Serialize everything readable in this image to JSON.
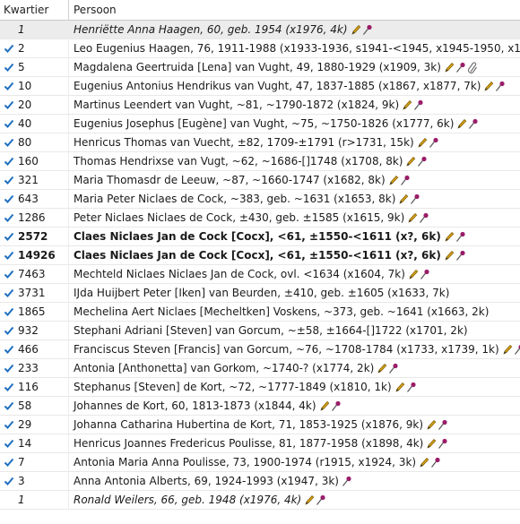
{
  "header": {
    "col_kwartier": "Kwartier",
    "col_persoon": "Persoon"
  },
  "colors": {
    "check": "#1e6fbf",
    "pencil": "#d4a017",
    "pin": "#9b1c6a",
    "clip": "#6b6b6b",
    "shade": "#ececec"
  },
  "rows": [
    {
      "kw": "1",
      "name": "Henriëtte Anna Haagen, 60, geb. 1954 (x1976, 4k)",
      "check": false,
      "style": "italic",
      "icons": [
        "pencil-icon",
        "pin-icon"
      ]
    },
    {
      "kw": "2",
      "name": "Leo Eugenius Haagen, 76, 1911-1988 (x1933-1936, s1941-<1945, x1945-1950, x1954,",
      "check": true,
      "style": "normal",
      "icons": []
    },
    {
      "kw": "5",
      "name": "Magdalena Geertruida [Lena] van Vught, 49, 1880-1929 (x1909, 3k)",
      "check": true,
      "style": "normal",
      "icons": [
        "pencil-icon",
        "pin-icon",
        "paperclip-icon"
      ]
    },
    {
      "kw": "10",
      "name": "Eugenius Antonius Hendrikus van Vught, 47, 1837-1885 (x1867, x1877, 7k)",
      "check": true,
      "style": "normal",
      "icons": [
        "pencil-icon",
        "pin-icon"
      ]
    },
    {
      "kw": "20",
      "name": "Martinus Leendert van Vught, ~81, ~1790-1872 (x1824, 9k)",
      "check": true,
      "style": "normal",
      "icons": [
        "pencil-icon",
        "pin-icon"
      ]
    },
    {
      "kw": "40",
      "name": "Eugenius Josephus [Eugène] van Vught, ~75, ~1750-1826 (x1777, 6k)",
      "check": true,
      "style": "normal",
      "icons": [
        "pencil-icon",
        "pin-icon"
      ]
    },
    {
      "kw": "80",
      "name": "Henricus Thomas van Vuecht, ±82, 1709-±1791 (r>1731, 15k)",
      "check": true,
      "style": "normal",
      "icons": [
        "pencil-icon",
        "pin-icon"
      ]
    },
    {
      "kw": "160",
      "name": "Thomas Hendrixse van Vugt, ~62, ~1686-[]1748 (x1708, 8k)",
      "check": true,
      "style": "normal",
      "icons": [
        "pencil-icon",
        "pin-icon"
      ]
    },
    {
      "kw": "321",
      "name": "Maria Thomasdr de Leeuw, ~87, ~1660-1747 (x1682, 8k)",
      "check": true,
      "style": "normal",
      "icons": [
        "pencil-icon",
        "pin-icon"
      ]
    },
    {
      "kw": "643",
      "name": "Maria Peter Niclaes de Cock, ~383, geb. ~1631 (x1653, 8k)",
      "check": true,
      "style": "normal",
      "icons": [
        "pencil-icon",
        "pin-icon"
      ]
    },
    {
      "kw": "1286",
      "name": "Peter Niclaes Niclaes de Cock, ±430, geb. ±1585 (x1615, 9k)",
      "check": true,
      "style": "normal",
      "icons": [
        "pencil-icon",
        "pin-icon"
      ]
    },
    {
      "kw": "2572",
      "name": "Claes Niclaes Jan de Cock [Cocx], <61, ±1550-<1611 (x?, 6k)",
      "check": true,
      "style": "bold",
      "icons": [
        "pencil-icon",
        "pin-icon"
      ]
    },
    {
      "kw": "14926",
      "name": "Claes Niclaes Jan de Cock [Cocx], <61, ±1550-<1611 (x?, 6k)",
      "check": true,
      "style": "bold",
      "icons": [
        "pencil-icon",
        "pin-icon"
      ]
    },
    {
      "kw": "7463",
      "name": "Mechteld Niclaes Niclaes Jan de Cock, ovl. <1634 (x1604, 7k)",
      "check": true,
      "style": "normal",
      "icons": [
        "pencil-icon",
        "pin-icon"
      ]
    },
    {
      "kw": "3731",
      "name": "IJda Huijbert Peter [Iken] van Beurden, ±410, geb. ±1605 (x1633, 7k)",
      "check": true,
      "style": "normal",
      "icons": []
    },
    {
      "kw": "1865",
      "name": "Mechelina Aert Niclaes [Mecheltken] Voskens, ~373, geb. ~1641 (x1663, 2k)",
      "check": true,
      "style": "normal",
      "icons": []
    },
    {
      "kw": "932",
      "name": "Stephani Adriani [Steven] van Gorcum, ~±58, ±1664-[]1722 (x1701, 2k)",
      "check": true,
      "style": "normal",
      "icons": []
    },
    {
      "kw": "466",
      "name": "Franciscus Steven [Francis] van Gorcum, ~76, ~1708-1784 (x1733, x1739, 1k)",
      "check": true,
      "style": "normal",
      "icons": [
        "pencil-icon",
        "pin-icon"
      ]
    },
    {
      "kw": "233",
      "name": "Antonia [Anthonetta] van Gorkom, ~1740-? (x1774, 2k)",
      "check": true,
      "style": "normal",
      "icons": [
        "pencil-icon",
        "pin-icon"
      ]
    },
    {
      "kw": "116",
      "name": "Stephanus [Steven] de Kort, ~72, ~1777-1849 (x1810, 1k)",
      "check": true,
      "style": "normal",
      "icons": [
        "pencil-icon",
        "pin-icon"
      ]
    },
    {
      "kw": "58",
      "name": "Johannes de Kort, 60, 1813-1873 (x1844, 4k)",
      "check": true,
      "style": "normal",
      "icons": [
        "pencil-icon",
        "pin-icon"
      ]
    },
    {
      "kw": "29",
      "name": "Johanna Catharina Hubertina de Kort, 71, 1853-1925 (x1876, 9k)",
      "check": true,
      "style": "normal",
      "icons": [
        "pencil-icon",
        "pin-icon"
      ]
    },
    {
      "kw": "14",
      "name": "Henricus Joannes Fredericus Poulisse, 81, 1877-1958 (x1898, 4k)",
      "check": true,
      "style": "normal",
      "icons": [
        "pencil-icon",
        "pin-icon"
      ]
    },
    {
      "kw": "7",
      "name": "Antonia Maria Anna Poulisse, 73, 1900-1974 (r1915, x1924, 3k)",
      "check": true,
      "style": "normal",
      "icons": [
        "pencil-icon",
        "pin-icon"
      ]
    },
    {
      "kw": "3",
      "name": "Anna Antonia Alberts, 69, 1924-1993 (x1947, 3k)",
      "check": true,
      "style": "normal",
      "icons": [
        "pin-icon"
      ]
    },
    {
      "kw": "1",
      "name": "Ronald Weilers, 66, geb. 1948 (x1976, 4k)",
      "check": false,
      "style": "italic",
      "icons": [
        "pencil-icon",
        "pin-icon"
      ]
    }
  ]
}
